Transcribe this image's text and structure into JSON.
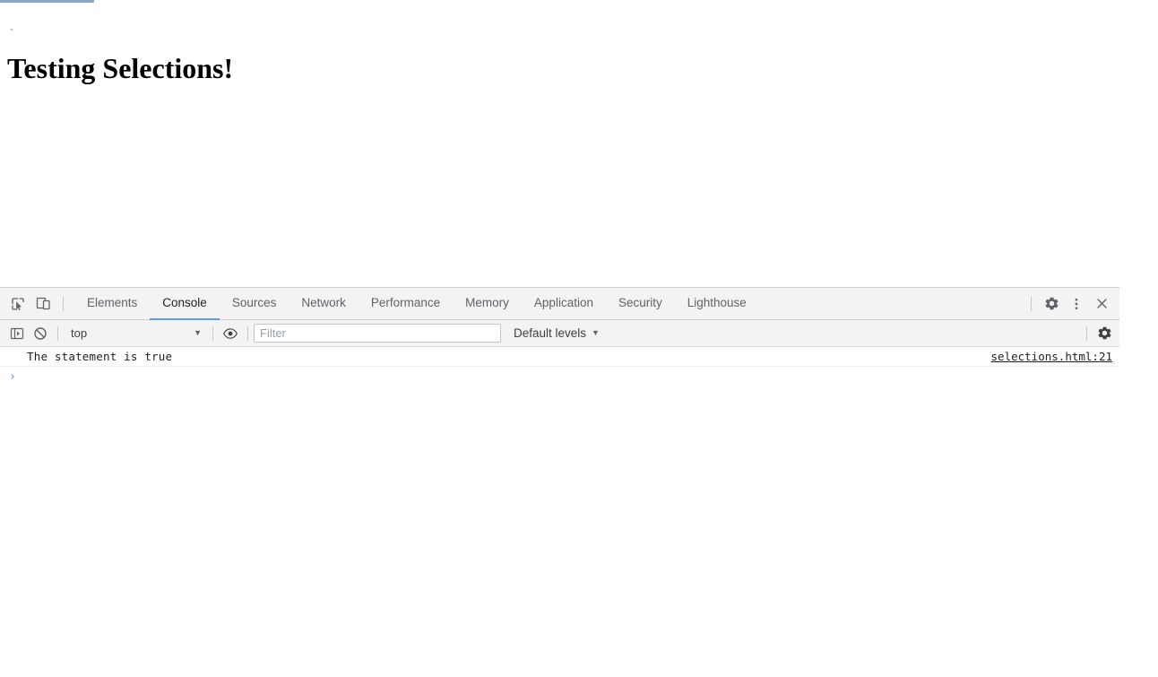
{
  "page": {
    "title": "Testing Selections!",
    "background_color": "#ffffff",
    "tab_sliver_color": "#8ba7c6"
  },
  "devtools": {
    "accent_color": "#5b9bf2",
    "toolbar_background": "#f3f3f3",
    "left_tools": [
      {
        "name": "inspect-element-icon",
        "label": "Inspect element"
      },
      {
        "name": "device-toolbar-icon",
        "label": "Toggle device toolbar"
      }
    ],
    "tabs": [
      {
        "label": "Elements",
        "selected": false
      },
      {
        "label": "Console",
        "selected": true
      },
      {
        "label": "Sources",
        "selected": false
      },
      {
        "label": "Network",
        "selected": false
      },
      {
        "label": "Performance",
        "selected": false
      },
      {
        "label": "Memory",
        "selected": false
      },
      {
        "label": "Application",
        "selected": false
      },
      {
        "label": "Security",
        "selected": false
      },
      {
        "label": "Lighthouse",
        "selected": false
      }
    ],
    "right_tools": [
      {
        "name": "settings-gear-icon",
        "label": "Settings"
      },
      {
        "name": "more-options-kebab-icon",
        "label": "Customize and control DevTools"
      },
      {
        "name": "close-devtools-icon",
        "label": "Close DevTools"
      }
    ],
    "console_toolbar": {
      "sidebar_toggle_label": "Show console sidebar",
      "clear_console_label": "Clear console",
      "context": {
        "value": "top",
        "caret": "▼"
      },
      "eye_label": "Create live expression",
      "filter": {
        "value": "",
        "placeholder": "Filter"
      },
      "levels": {
        "value": "Default levels",
        "caret": "▼"
      },
      "settings_label": "Console settings"
    },
    "console_messages": [
      {
        "text": "The statement is true",
        "source": "selections.html:21"
      }
    ],
    "prompt": {
      "caret": "›",
      "value": ""
    }
  }
}
